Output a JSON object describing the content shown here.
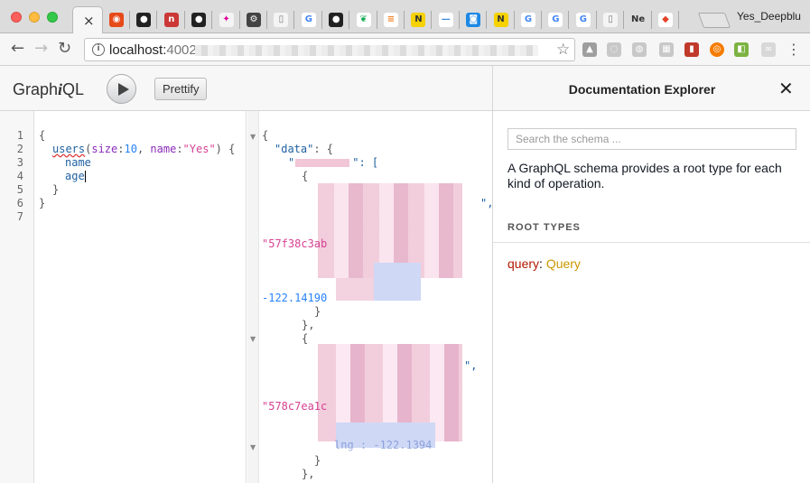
{
  "browser": {
    "active_tab_close": "×",
    "tabs": [
      {
        "icon": "opera-icon",
        "glyph": "◉",
        "bg": "#e64a19",
        "fg": "#fff"
      },
      {
        "icon": "github-icon",
        "glyph": "●",
        "bg": "#222",
        "fg": "#fff"
      },
      {
        "icon": "npm-icon",
        "glyph": "n",
        "bg": "#cb3837",
        "fg": "#fff"
      },
      {
        "icon": "github-icon",
        "glyph": "●",
        "bg": "#222",
        "fg": "#fff"
      },
      {
        "icon": "graphql-icon",
        "glyph": "✦",
        "bg": "#f4f4f4",
        "fg": "#e10098"
      },
      {
        "icon": "tools-icon",
        "glyph": "⚙",
        "bg": "#444",
        "fg": "#fff"
      },
      {
        "icon": "document-icon",
        "glyph": "▯",
        "bg": "#f4f4f4",
        "fg": "#777"
      },
      {
        "icon": "google-icon",
        "glyph": "G",
        "bg": "#fff",
        "fg": "#4285f4"
      },
      {
        "icon": "github-icon",
        "glyph": "●",
        "bg": "#222",
        "fg": "#fff"
      },
      {
        "icon": "mongodb-icon",
        "glyph": "❦",
        "bg": "#fff",
        "fg": "#13aa52"
      },
      {
        "icon": "stackoverflow-icon",
        "glyph": "≡",
        "bg": "#fff",
        "fg": "#f48024"
      },
      {
        "icon": "node-icon",
        "glyph": "N",
        "bg": "#f5d200",
        "fg": "#333"
      },
      {
        "icon": "dash-icon",
        "glyph": "—",
        "bg": "#fff",
        "fg": "#3b8de0"
      },
      {
        "icon": "chat-icon",
        "glyph": "◙",
        "bg": "#1e88e5",
        "fg": "#fff"
      },
      {
        "icon": "node-icon",
        "glyph": "N",
        "bg": "#f5d200",
        "fg": "#333"
      },
      {
        "icon": "google-icon",
        "glyph": "G",
        "bg": "#fff",
        "fg": "#4285f4"
      },
      {
        "icon": "google-icon",
        "glyph": "G",
        "bg": "#fff",
        "fg": "#4285f4"
      },
      {
        "icon": "google-icon",
        "glyph": "G",
        "bg": "#fff",
        "fg": "#4285f4"
      },
      {
        "icon": "document-icon",
        "glyph": "▯",
        "bg": "#f4f4f4",
        "fg": "#777"
      },
      {
        "icon": "tab-text",
        "glyph": "Ne",
        "bg": "transparent",
        "fg": "#333"
      },
      {
        "icon": "gitlab-icon",
        "glyph": "◆",
        "bg": "#fff",
        "fg": "#e24329"
      }
    ],
    "profile_name": "Yes_Deepblu",
    "url_host": "localhost:",
    "url_port": "4002"
  },
  "graphiql": {
    "title_prefix": "Graph",
    "title_i": "i",
    "title_suffix": "QL",
    "prettify_label": "Prettify"
  },
  "query_editor": {
    "line_numbers": [
      "1",
      "2",
      "3",
      "4",
      "5",
      "6",
      "7"
    ],
    "open_brace": "{",
    "field": "users",
    "paren_open": "(",
    "arg1_name": "size",
    "colon": ":",
    "arg1_value": "10",
    "comma": ", ",
    "arg2_name": "name",
    "arg2_value": "\"Yes\"",
    "paren_close": ") {",
    "sub_field1": "name",
    "sub_field2": "age",
    "close_inner": "}",
    "close_outer": "}"
  },
  "result_pane": {
    "line1": "{",
    "data_key": "\"data\"",
    "data_sep": ": {",
    "users_key_prefix": "\"",
    "users_key_suffix": "\": [",
    "obj_open": "{",
    "line_comma1": "\",",
    "line_comma2": ",",
    "id1": "\"57f38c3ab",
    "num1": "-122.14190",
    "obj_close1": "}",
    "arr_item_close": "},",
    "obj_open2": "{",
    "line_comma3": "\",",
    "id2": "\"578c7ea1c",
    "lng_fragment": "lng : -122.1394",
    "obj_close2": "}",
    "arr_item_close2": "},"
  },
  "docs": {
    "title": "Documentation Explorer",
    "close_glyph": "✕",
    "search_placeholder": "Search the schema ...",
    "description": "A GraphQL schema provides a root type for each kind of operation.",
    "section_label": "ROOT TYPES",
    "root_keyword": "query",
    "root_sep": ": ",
    "root_type": "Query"
  }
}
